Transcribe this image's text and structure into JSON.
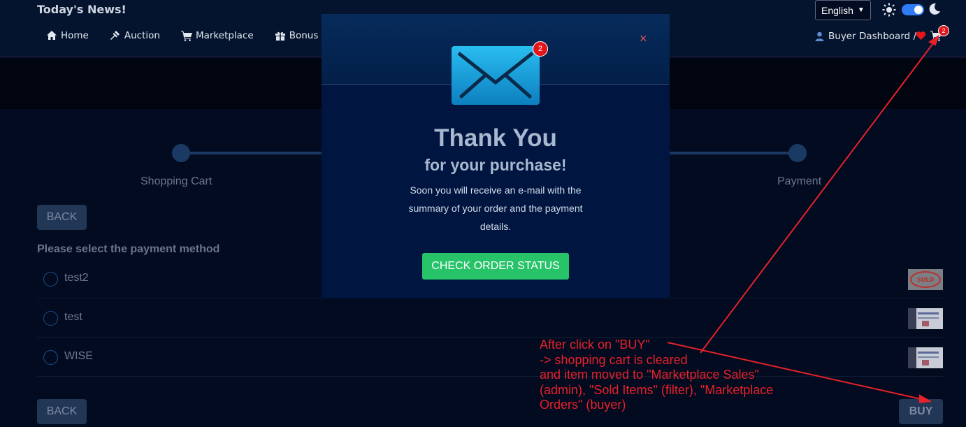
{
  "header": {
    "news_title": "Today's News!",
    "nav": [
      {
        "label": "Home",
        "icon": "home-icon"
      },
      {
        "label": "Auction",
        "icon": "gavel-icon"
      },
      {
        "label": "Marketplace",
        "icon": "cart-icon"
      },
      {
        "label": "Bonus Sch",
        "icon": "gift-icon"
      }
    ],
    "language": "English",
    "buyer_dashboard": "Buyer Dashboard /",
    "cart_count": "2"
  },
  "stepper": {
    "steps": [
      {
        "label": "Shopping Cart"
      },
      {
        "label": "Payment"
      }
    ]
  },
  "payment": {
    "back_label": "BACK",
    "heading": "Please select the payment method",
    "methods": [
      {
        "name": "test2"
      },
      {
        "name": "test"
      },
      {
        "name": "WISE"
      }
    ],
    "buy_label": "BUY"
  },
  "modal": {
    "badge": "2",
    "title": "Thank You",
    "subtitle": "for your purchase!",
    "message": "Soon you will receive an e-mail with the summary of your order and the payment details.",
    "button": "CHECK ORDER STATUS",
    "close": "×"
  },
  "annotation": {
    "lines": [
      "After click on \"BUY\"",
      "-> shopping cart is cleared",
      "and item moved to \"Marketplace Sales\"",
      "(admin), \"Sold Items\" (filter), \"Marketplace",
      "Orders\" (buyer)"
    ],
    "color": "#e8212a"
  }
}
